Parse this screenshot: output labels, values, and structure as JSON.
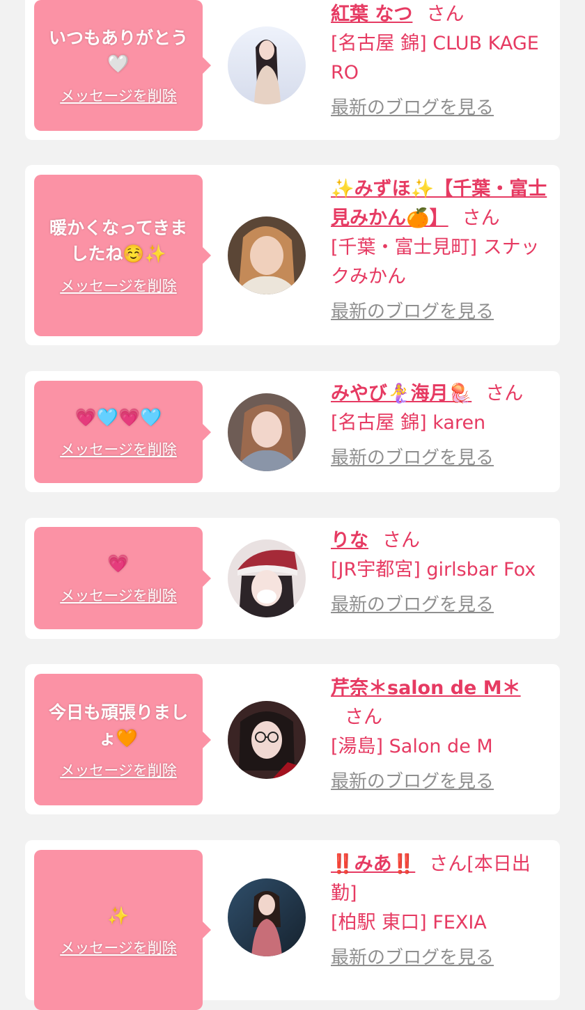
{
  "delete_label": "メッセージを削除",
  "blog_label": "最新のブログを見る",
  "cards": [
    {
      "message": "いつもありがとう🤍",
      "name": "紅葉 なつ",
      "honorific": "さん",
      "shop": "[名古屋 錦] CLUB KAGERO"
    },
    {
      "message": "暖かくなってきましたね☺️✨",
      "name": "✨みずほ✨【千葉・富士見みかん🍊】",
      "honorific": "さん",
      "shop": "[千葉・富士見町] スナックみかん"
    },
    {
      "message": "💗🩵💗🩵",
      "name": "みやび🧜‍♀️海月🪼",
      "honorific": "さん",
      "shop": "[名古屋 錦] karen"
    },
    {
      "message": "💗",
      "name": "りな",
      "honorific": "さん",
      "shop": "[JR宇都宮] girlsbar Fox"
    },
    {
      "message": "今日も頑張りましょ🧡",
      "name": "芹奈＊salon de M＊",
      "honorific": "さん",
      "shop": "[湯島] Salon de M"
    },
    {
      "message": "✨",
      "name": "‼️みあ‼️",
      "honorific": "さん[本日出勤]",
      "shop": "[柏駅 東口] FEXIA"
    }
  ],
  "colors": {
    "background": "#f2f2f2",
    "bubble": "#fb92a5",
    "accent": "#e63a62",
    "link_gray": "#8f8f8f"
  }
}
